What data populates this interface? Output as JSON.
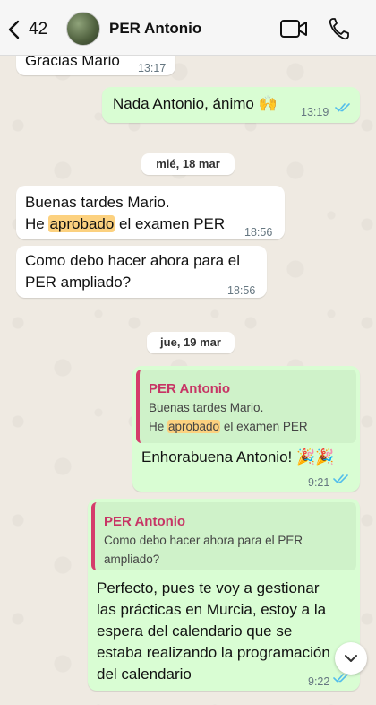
{
  "header": {
    "back_count": "42",
    "contact_name": "PER Antonio",
    "icons": [
      "back-chevron-icon",
      "video-call-icon",
      "phone-call-icon"
    ]
  },
  "messages": [
    {
      "direction": "in",
      "text": "Gracias Mario",
      "time": "13:17"
    },
    {
      "direction": "out",
      "text": "Nada Antonio, ánimo 🙌",
      "time": "13:19",
      "read": true
    },
    {
      "type": "date",
      "text": "mié, 18 mar"
    },
    {
      "direction": "in",
      "text_line1": "Buenas tardes Mario.",
      "text_line2_pre": "He ",
      "text_line2_hl": "aprobado",
      "text_line2_post": " el examen PER",
      "time": "18:56"
    },
    {
      "direction": "in",
      "text_line1": "Como debo hacer ahora para el",
      "text_line2": "PER ampliado?",
      "time": "18:56"
    },
    {
      "type": "date",
      "text": "jue, 19 mar"
    },
    {
      "direction": "out",
      "quote_author": "PER Antonio",
      "quote_line1": "Buenas tardes Mario.",
      "quote_line2_pre": "He ",
      "quote_line2_hl": "aprobado",
      "quote_line2_post": " el examen PER",
      "text": "Enhorabuena Antonio! 🎉🎉",
      "time": "9:21",
      "read": true
    },
    {
      "direction": "out",
      "quote_author": "PER Antonio",
      "quote_line1": "Como debo hacer ahora para el PER",
      "quote_line2": "ampliado?",
      "lines": [
        "Perfecto, pues te voy a gestionar",
        "las prácticas en Murcia, estoy a la",
        "espera del calendario que se",
        "estaba realizando la programación",
        "del calendario"
      ],
      "time": "9:22",
      "read": true
    }
  ],
  "colors": {
    "chat_bg": "#efeae2",
    "incoming": "#ffffff",
    "outgoing": "#d9fdd3",
    "read_ticks": "#53bdeb",
    "quote_accent": "#c73565",
    "highlight": "#fcd17f"
  }
}
